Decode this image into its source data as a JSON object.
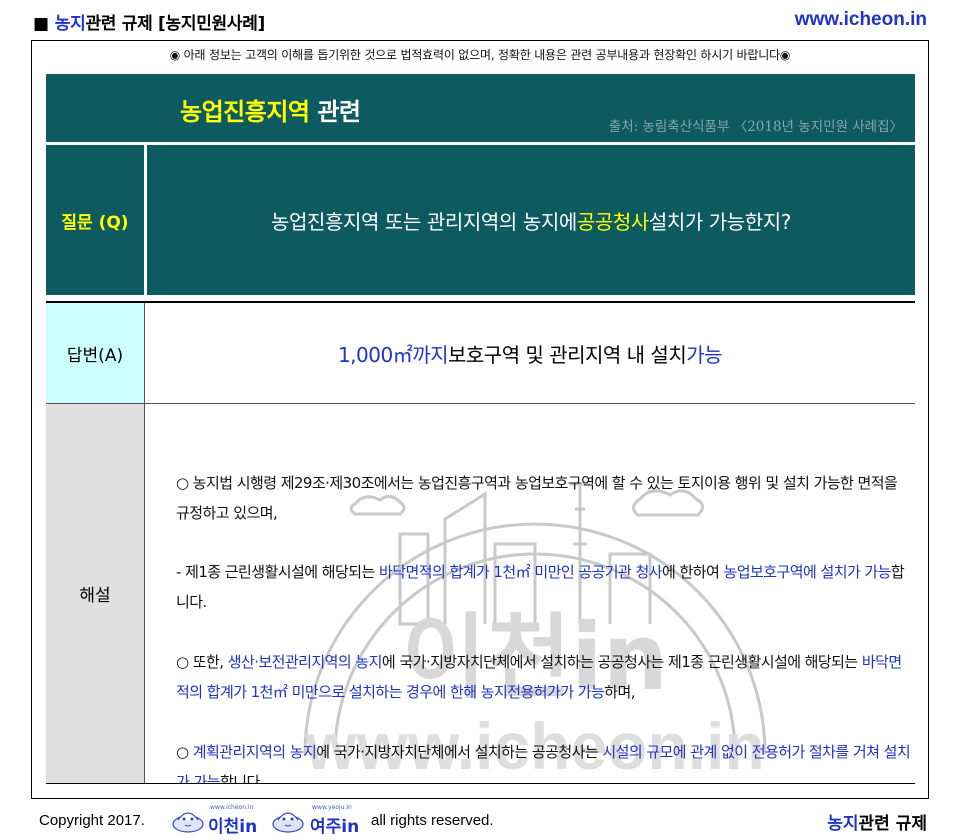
{
  "header": {
    "mark": "■",
    "title_highlight": "농지",
    "title_rest": "관련 규제 [농지민원사례]",
    "url": "www.icheon.in"
  },
  "notice": "◉ 아래 정보는 고객의 이해를 돕기위한 것으로 법적효력이 없으며, 정확한 내용은 관련 공부내용과 현장확인 하시기 바랍니다◉",
  "title_bar": {
    "title_highlight": "농업진흥지역",
    "title_rest": " 관련",
    "source": "출처: 농림축산식품부 〈2018년 농지민원 사례집〉"
  },
  "question": {
    "label": "질문 (Q)",
    "text_before": "농업진흥지역 또는 관리지역의 농지에 ",
    "text_highlight": "공공청사",
    "text_after": " 설치가 가능한지?"
  },
  "answer": {
    "label": "답변(A)",
    "part1": "1,000㎡까지",
    "part2": " 보호구역 및 관리지역 내 설치 ",
    "part3": "가능"
  },
  "explanation": {
    "label": "해설",
    "p1": "○  농지법 시행령  제29조·제30조에서는 농업진흥구역과 농업보호구역에 할 수 있는 토지이용 행위 및 설치 가능한 면적을 규정하고 있으며,",
    "p2": {
      "s1": "  - 제1종 근린생활시설에 해당되는 ",
      "s2": "바닥면적의 합계가 1천㎡ 미만인 공공기관 청사",
      "s3": "에 한하여 ",
      "s4": "농업보호구역에 설치가 가능",
      "s5": "합니다."
    },
    "p3": {
      "s1": "○ 또한, ",
      "s2": "생산·보전관리지역의 농지",
      "s3": "에 국가·지방자치단체에서 설치하는 공공청사는 제1종 근린생활시설에 해당되는 ",
      "s4": "바닥면적의 합계가 1천㎡ 미만으로 설치하는 경우에 한해 농지전용허가가 가능",
      "s5": "하며,"
    },
    "p4": {
      "s1": "○ ",
      "s2": "계획관리지역의 농지",
      "s3": "에 국가·지방자치단체에서 설치하는 공공청사는 ",
      "s4": "시설의 규모에 관계 없이 전용허가 절차를 거쳐 설치가 가능",
      "s5": "합니다."
    },
    "watermark_name": "이천in",
    "watermark_url": "www.icheon.in"
  },
  "footer": {
    "copyright": "Copyright 2017.",
    "logo1_name": "이천in",
    "logo1_url": "www.icheon.in",
    "logo2_name": "여주in",
    "logo2_url": "www.yeoju.in",
    "rights": "all rights reserved.",
    "right_highlight": "농지",
    "right_rest": "관련 규제"
  },
  "colors": {
    "teal": "#0d5a61",
    "blue": "#1f33c8",
    "yellow": "#ffff00",
    "answer_bg": "#ccffff",
    "explain_bg": "#e0e0e0"
  },
  "icons": [
    "square-bullet-icon",
    "mascot-icon",
    "watermark-seal"
  ]
}
